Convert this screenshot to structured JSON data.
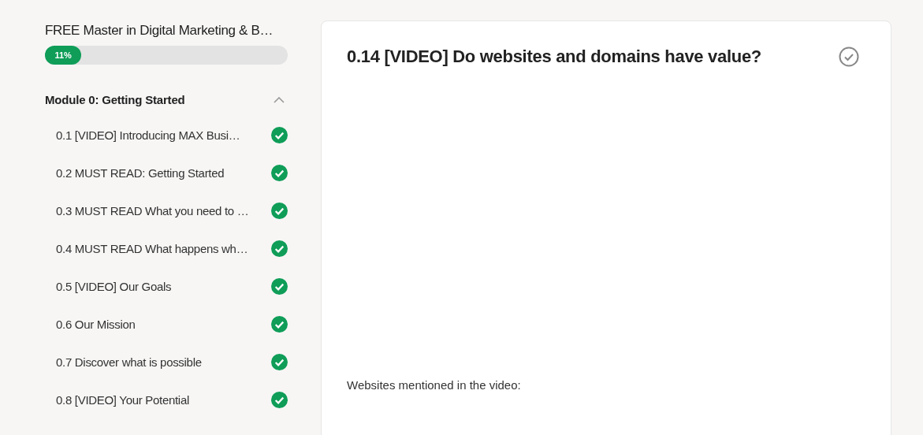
{
  "course": {
    "title": "FREE Master in Digital Marketing & B…",
    "progress": {
      "label": "11%",
      "level": 0.11
    }
  },
  "modules": [
    {
      "title": "Module 0: Getting Started",
      "expanded": true,
      "lessons": [
        {
          "title": "0.1 [VIDEO] Introducing MAX Busi…",
          "completed": true
        },
        {
          "title": "0.2 MUST READ: Getting Started",
          "completed": true
        },
        {
          "title": "0.3 MUST READ What you need to …",
          "completed": true
        },
        {
          "title": "0.4 MUST READ What happens wh…",
          "completed": true
        },
        {
          "title": "0.5 [VIDEO] Our Goals",
          "completed": true
        },
        {
          "title": "0.6 Our Mission",
          "completed": true
        },
        {
          "title": "0.7 Discover what is possible",
          "completed": true
        },
        {
          "title": "0.8 [VIDEO] Your Potential",
          "completed": true
        }
      ]
    }
  ],
  "lesson": {
    "title": "0.14 [VIDEO] Do websites and domains have value?",
    "completed": false,
    "body": "Websites mentioned in the video:"
  }
}
